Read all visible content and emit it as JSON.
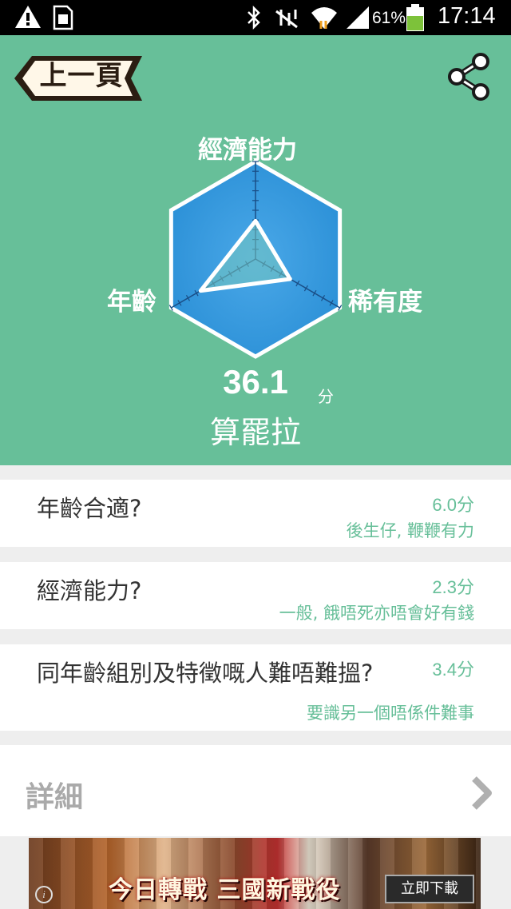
{
  "status_bar": {
    "battery_percent": "61%",
    "time": "17:14",
    "icons": [
      "warning-icon",
      "sim-icon",
      "bluetooth-icon",
      "mute-icon",
      "wifi-icon",
      "signal-icon",
      "battery-icon"
    ]
  },
  "header": {
    "back_label": "上一頁",
    "share_icon": "share-icon",
    "background": "#67bf99"
  },
  "radar": {
    "axes": [
      "經濟能力",
      "稀有度",
      "年齡"
    ],
    "values": [
      0.39,
      0.41,
      0.65
    ],
    "fill_color": "#2a8fd6",
    "outline_color": "#ffffff"
  },
  "score": {
    "value": "36.1",
    "unit": "分",
    "verdict": "算罷拉"
  },
  "items": [
    {
      "question": "年齡合適?",
      "score": "6.0分",
      "comment": "後生仔, 鞭鞭有力"
    },
    {
      "question": "經濟能力?",
      "score": "2.3分",
      "comment": "一般, 餓唔死亦唔會好有錢"
    },
    {
      "question": "同年齡組別及特徵嘅人難唔難搵?",
      "score": "3.4分",
      "comment": "要識另一個唔係件難事"
    }
  ],
  "detail": {
    "label": "詳細",
    "icon": "chevron-right-icon"
  },
  "ad": {
    "title": "今日轉戰 三國新戰役",
    "button_label": "立即下載",
    "info_icon": "info-icon"
  }
}
